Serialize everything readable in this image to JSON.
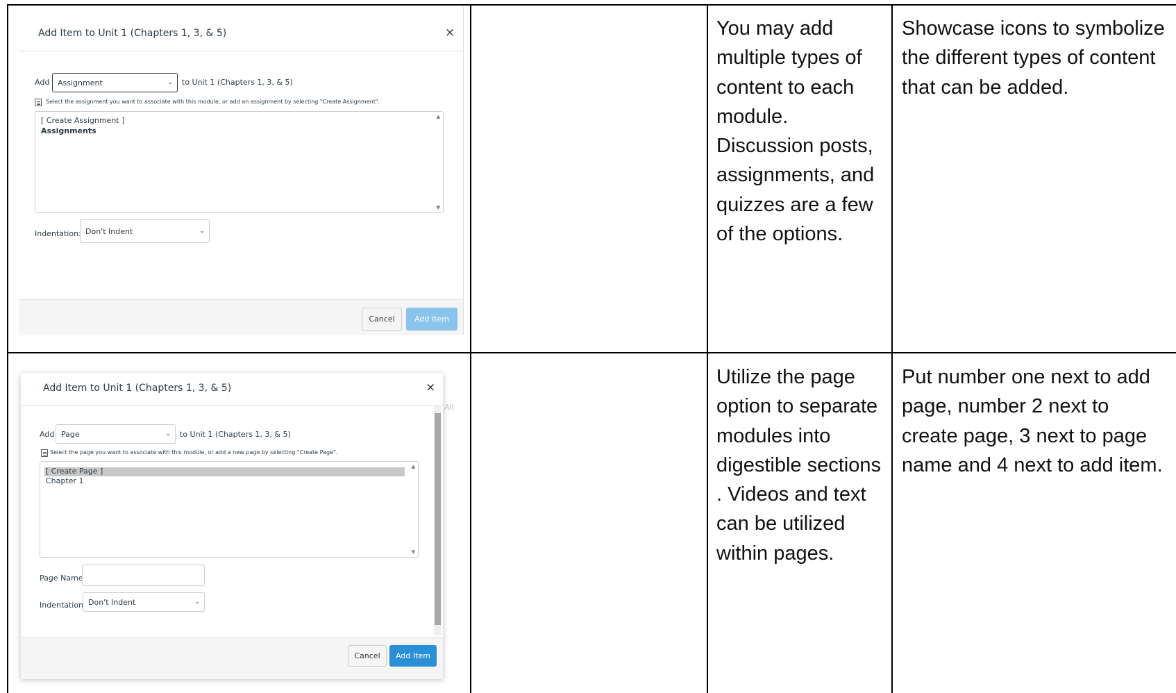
{
  "row1": {
    "dialog": {
      "title": "Add Item to Unit 1 (Chapters 1, 3, & 5)",
      "close": "×",
      "add_label": "Add",
      "type_select": "Assignment",
      "to_label": "to Unit 1 (Chapters 1, 3, & 5)",
      "hint": "Select the assignment you want to associate with this module, or add an assignment by selecting \"Create Assignment\".",
      "list_items": [
        "[ Create Assignment ]",
        "Assignments"
      ],
      "indentation_label": "Indentation:",
      "indentation_select": "Don't Indent",
      "cancel": "Cancel",
      "add_item": "Add Item"
    },
    "description": "You may add multiple types of content to each module. Discussion posts, assignments, and quizzes are a few of the options.",
    "suggestion": "Showcase icons to symbolize the different types of content that can be added."
  },
  "row2": {
    "dialog": {
      "title": "Add Item to Unit 1 (Chapters 1, 3, & 5)",
      "close": "×",
      "add_label": "Add",
      "type_select": "Page",
      "to_label": "to Unit 1 (Chapters 1, 3, & 5)",
      "hint": "Select the page you want to associate with this module, or add a new page by selecting \"Create Page\".",
      "list_items": [
        "[ Create Page ]",
        "Chapter 1"
      ],
      "page_name_label": "Page Name:",
      "indentation_label": "Indentation:",
      "indentation_select": "Don't Indent",
      "cancel": "Cancel",
      "add_item": "Add Item",
      "background_text": "All"
    },
    "description": "Utilize the page option to separate modules into digestible sections . Videos and text can be utilized within pages.",
    "suggestion": "Put number one next to add page, number 2 next to create page, 3 next to page name and 4 next to add item."
  },
  "colors": {
    "add_button_disabled": "#8ac4ec",
    "add_button": "#2b8fd6",
    "selected_row": "#c8c8c8"
  }
}
